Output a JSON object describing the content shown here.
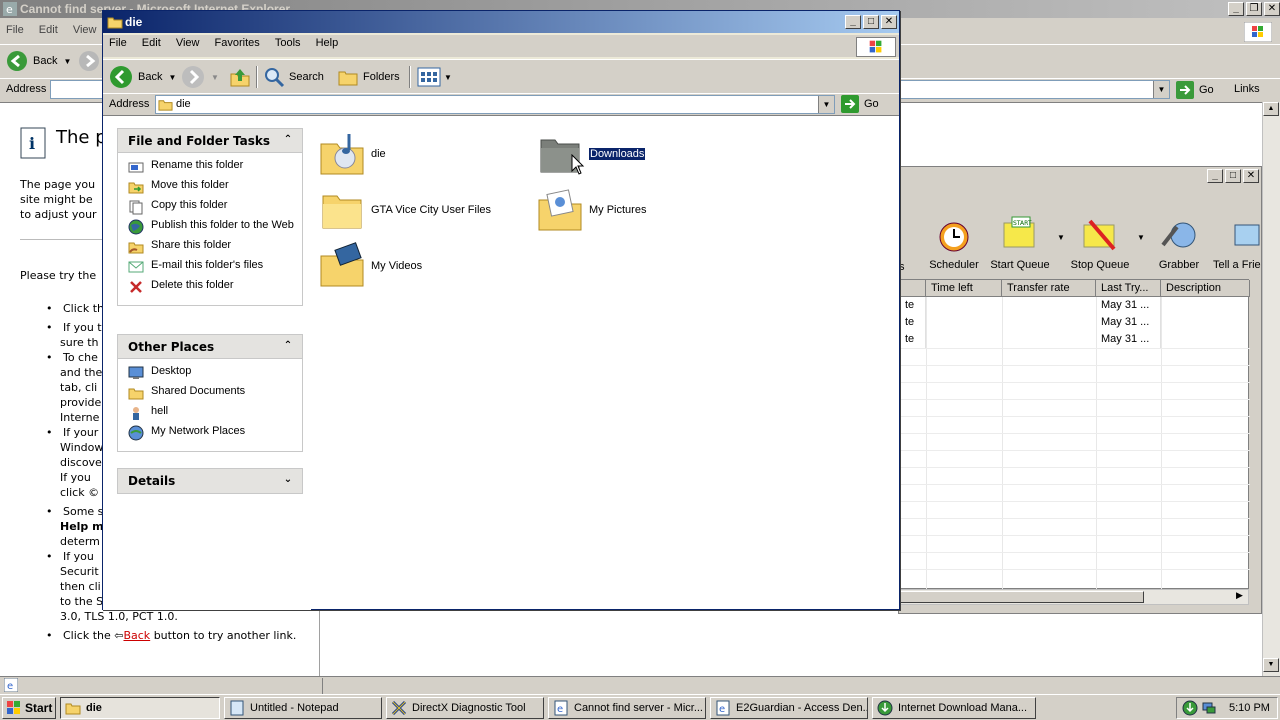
{
  "ie": {
    "title": "Cannot find server - Microsoft Internet Explorer",
    "menu": [
      "File",
      "Edit",
      "View"
    ],
    "back_label": "Back",
    "address_label": "Address",
    "go_label": "Go",
    "links_label": "Links",
    "page_heading": "The p",
    "intro_lines": [
      "The page you",
      "site might be",
      "to adjust your"
    ],
    "please_try": "Please try the",
    "bullets": [
      "Click th",
      "If you t",
      "sure th",
      "To che",
      "and the",
      "tab, cli",
      "provide",
      "Interne",
      "If your",
      "Window",
      "discove",
      "If you",
      "click",
      "Some s",
      "Help m",
      "determ",
      "If you",
      "Securit",
      "then cli",
      "to the S",
      "3.0, TLS 1.0, PCT 1.0."
    ],
    "last_bullet_prefix": "Click the",
    "last_bullet_link": "Back",
    "last_bullet_suffix": "button to try another link."
  },
  "idm": {
    "tools": [
      "Scheduler",
      "Start Queue",
      "Stop Queue",
      "Grabber",
      "Tell a Frie"
    ],
    "partial_tool": "s",
    "columns": [
      "Time left",
      "Transfer rate",
      "Last Try...",
      "Description"
    ],
    "rows": [
      {
        "status": "te",
        "last_try": "May 31 ..."
      },
      {
        "status": "te",
        "last_try": "May 31 ..."
      },
      {
        "status": "te",
        "last_try": "May 31 ..."
      }
    ]
  },
  "explorer": {
    "title": "die",
    "menu": [
      "File",
      "Edit",
      "View",
      "Favorites",
      "Tools",
      "Help"
    ],
    "toolbar": {
      "back": "Back",
      "search": "Search",
      "folders": "Folders"
    },
    "address_label": "Address",
    "address_value": "die",
    "go_label": "Go",
    "file_tasks": {
      "title": "File and Folder Tasks",
      "items": [
        "Rename this folder",
        "Move this folder",
        "Copy this folder",
        "Publish this folder to the Web",
        "Share this folder",
        "E-mail this folder's files",
        "Delete this folder"
      ]
    },
    "other_places": {
      "title": "Other Places",
      "items": [
        "Desktop",
        "Shared Documents",
        "hell",
        "My Network Places"
      ]
    },
    "details": {
      "title": "Details"
    },
    "files": [
      {
        "name": "die"
      },
      {
        "name": "Downloads"
      },
      {
        "name": "GTA Vice City User Files"
      },
      {
        "name": "My Pictures"
      },
      {
        "name": "My Videos"
      }
    ]
  },
  "taskbar": {
    "start": "Start",
    "tasks": [
      "die",
      "Untitled - Notepad",
      "DirectX Diagnostic Tool",
      "Cannot find server - Micr...",
      "E2Guardian - Access Den...",
      "Internet Download Mana..."
    ],
    "clock": "5:10 PM"
  }
}
